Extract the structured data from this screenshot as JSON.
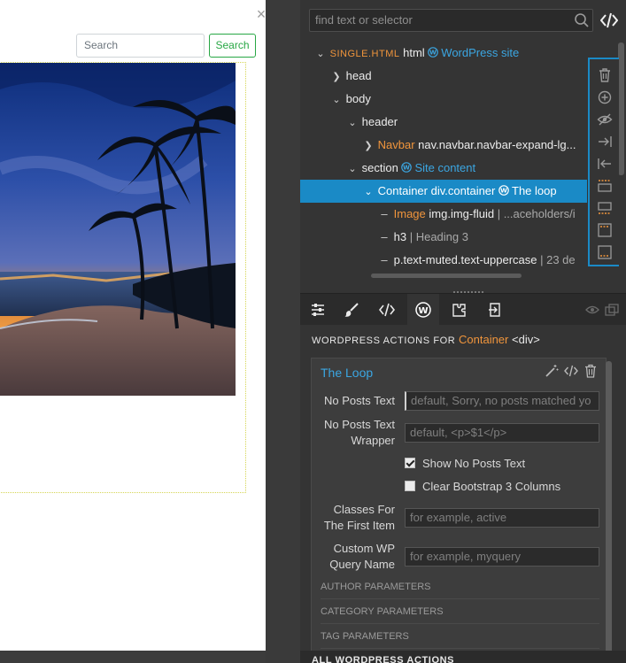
{
  "canvas": {
    "search_placeholder": "Search",
    "search_button": "Search"
  },
  "panel": {
    "find_placeholder": "find text or selector",
    "tree": {
      "root": {
        "label": "SINGLE.HTML",
        "tag": "html",
        "wp_label": "WordPress site"
      },
      "rows": [
        {
          "name": "head"
        },
        {
          "name": "body"
        },
        {
          "name": "header"
        },
        {
          "component": "Navbar",
          "selector": "nav.navbar.navbar-expand-lg..."
        },
        {
          "name": "section",
          "wp_label": "Site content"
        },
        {
          "component": "Container",
          "selector": "div.container",
          "wp_label": "The loop"
        },
        {
          "component": "Image",
          "selector": "img.img-fluid",
          "note": "| ...aceholders/i"
        },
        {
          "name": "h3",
          "note": "| Heading 3"
        },
        {
          "name": "p.text-muted.text-uppercase",
          "note": "| 23 de"
        }
      ]
    },
    "wp_actions": {
      "heading_prefix": "WORDPRESS ACTIONS FOR",
      "element_name": "Container",
      "element_tag": "<div>",
      "card_title": "The Loop",
      "fields": {
        "no_posts_text": {
          "label": "No Posts Text",
          "placeholder": "default, Sorry, no posts matched yo"
        },
        "no_posts_wrapper": {
          "label_line1": "No Posts Text",
          "label_line2": "Wrapper",
          "placeholder": "default, <p>$1</p>"
        },
        "show_no_posts": {
          "label": "Show No Posts Text",
          "checked": true
        },
        "clear_bs3": {
          "label": "Clear Bootstrap 3 Columns",
          "checked": false
        },
        "first_item_classes": {
          "label_line1": "Classes For",
          "label_line2": "The First Item",
          "placeholder": "for example, active"
        },
        "query_name": {
          "label_line1": "Custom WP",
          "label_line2": "Query Name",
          "placeholder": "for example, myquery"
        }
      },
      "sections": [
        "AUTHOR PARAMETERS",
        "CATEGORY PARAMETERS",
        "TAG PARAMETERS"
      ],
      "all_actions": "ALL WORDPRESS ACTIONS"
    }
  },
  "colors": {
    "selected_row": "#1a8ac6",
    "wp_blue": "#3ba6e2",
    "component_orange": "#f0953c",
    "search_green": "#28a745"
  }
}
